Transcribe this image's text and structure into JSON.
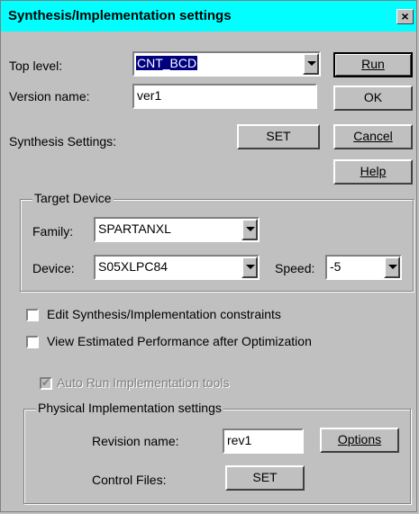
{
  "window": {
    "title": "Synthesis/Implementation settings",
    "close_glyph": "×"
  },
  "top_level": {
    "label": "Top level:",
    "value": "CNT_BCD"
  },
  "version_name": {
    "label": "Version name:",
    "value": "ver1"
  },
  "synthesis_settings": {
    "label": "Synthesis Settings:",
    "button": "SET"
  },
  "buttons": {
    "run": "Run",
    "ok": "OK",
    "cancel": "Cancel",
    "help": "Help"
  },
  "target_device": {
    "group_label": "Target Device",
    "family_label": "Family:",
    "family_value": "SPARTANXL",
    "device_label": "Device:",
    "device_value": "S05XLPC84",
    "speed_label": "Speed:",
    "speed_value": "-5"
  },
  "checkboxes": {
    "edit_constraints": {
      "label": "Edit Synthesis/Implementation constraints",
      "checked": false
    },
    "view_performance": {
      "label": "View Estimated Performance after Optimization",
      "checked": false
    },
    "auto_run": {
      "label": "Auto Run Implementation tools",
      "checked": true,
      "disabled": true
    }
  },
  "physical": {
    "group_label": "Physical Implementation settings",
    "revision_label": "Revision name:",
    "revision_value": "rev1",
    "options_button": "Options",
    "control_files_label": "Control Files:",
    "control_files_button": "SET"
  },
  "colors": {
    "titlebar": "#00ffff",
    "face": "#c0c0c0",
    "selection": "#000080"
  }
}
